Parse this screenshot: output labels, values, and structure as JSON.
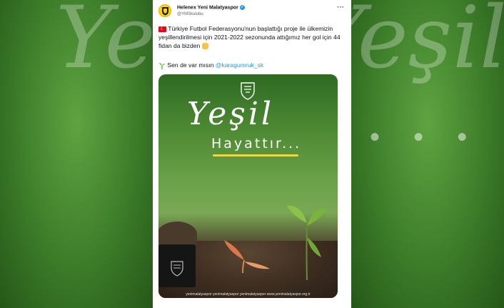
{
  "background": {
    "script_text": "Yeşil",
    "dots": "• • •"
  },
  "tweet": {
    "display_name": "Helenex Yeni Malatyaspor",
    "handle": "@YMSkulubu",
    "more_label": "···",
    "text_part1": " Türkiye Futbol Federasyonu'nun başlattığı proje ile ülkemizin yeşillendirilmesi için 2021-2022 sezonunda attığımız her gol için 44 fidan da bizden ",
    "text_line2_prefix": "Sen de var mısın ",
    "mention": "@karagumruk_sk"
  },
  "media": {
    "title_script": "Yeşil",
    "subtitle": "Hayattır...",
    "footer": "yenimalatyaspor   yenimalatyaspor   yenimalatyaspor   www.yenimalatyaspor.org.tr"
  },
  "colors": {
    "accent": "#1d9bf0",
    "brand_yellow": "#ffd400",
    "background_green": "#3f7a2e"
  },
  "icons": {
    "avatar": "club-crest-icon",
    "verified": "verified-badge-icon",
    "flag": "turkey-flag-icon",
    "fist": "fist-bump-icon",
    "seedling": "seedling-icon"
  }
}
